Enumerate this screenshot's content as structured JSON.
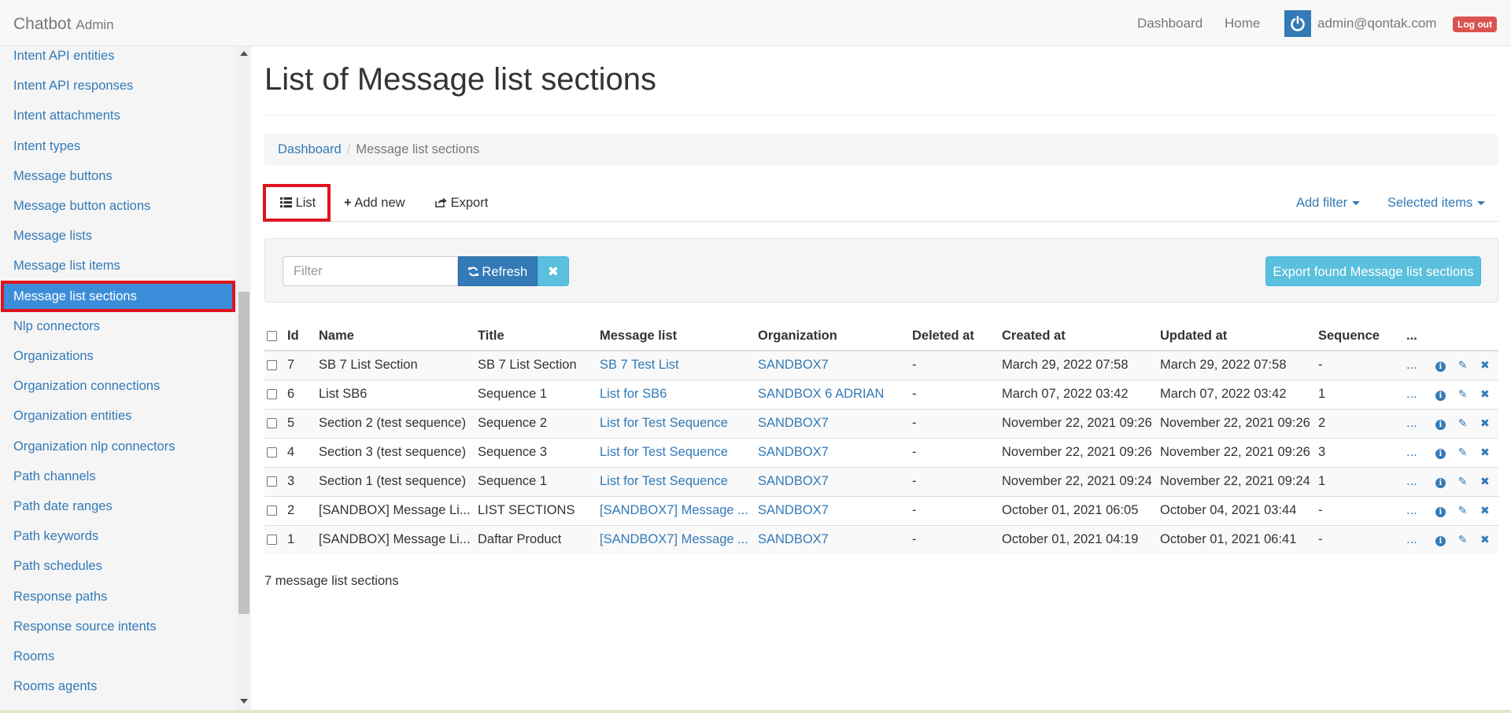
{
  "navbar": {
    "brand": "Chatbot",
    "brand_sub": "Admin",
    "dashboard": "Dashboard",
    "home": "Home",
    "user_email": "admin@qontak.com",
    "logout": "Log out"
  },
  "sidebar": {
    "items": [
      {
        "label": "Intent API entities"
      },
      {
        "label": "Intent API responses"
      },
      {
        "label": "Intent attachments"
      },
      {
        "label": "Intent types"
      },
      {
        "label": "Message buttons"
      },
      {
        "label": "Message button actions"
      },
      {
        "label": "Message lists"
      },
      {
        "label": "Message list items"
      },
      {
        "label": "Message list sections",
        "active": true
      },
      {
        "label": "Nlp connectors"
      },
      {
        "label": "Organizations"
      },
      {
        "label": "Organization connections"
      },
      {
        "label": "Organization entities"
      },
      {
        "label": "Organization nlp connectors"
      },
      {
        "label": "Path channels"
      },
      {
        "label": "Path date ranges"
      },
      {
        "label": "Path keywords"
      },
      {
        "label": "Path schedules"
      },
      {
        "label": "Response paths"
      },
      {
        "label": "Response source intents"
      },
      {
        "label": "Rooms"
      },
      {
        "label": "Rooms agents"
      }
    ]
  },
  "page": {
    "title": "List of Message list sections",
    "breadcrumb": {
      "home": "Dashboard",
      "current": "Message list sections"
    },
    "tabs": {
      "list": "List",
      "add_new": "Add new",
      "export": "Export"
    },
    "add_filter": "Add filter",
    "selected_items": "Selected items",
    "filter_placeholder": "Filter",
    "refresh": "Refresh",
    "export_found": "Export found Message list sections",
    "count_text": "7 message list sections"
  },
  "table": {
    "headers": {
      "id": "Id",
      "name": "Name",
      "title": "Title",
      "message_list": "Message list",
      "organization": "Organization",
      "deleted_at": "Deleted at",
      "created_at": "Created at",
      "updated_at": "Updated at",
      "sequence": "Sequence",
      "more": "..."
    },
    "rows": [
      {
        "id": "7",
        "name": "SB 7 List Section",
        "title": "SB 7 List Section",
        "message_list": "SB 7 Test List",
        "organization": "SANDBOX7",
        "deleted_at": "-",
        "created_at": "March 29, 2022 07:58",
        "updated_at": "March 29, 2022 07:58",
        "sequence": "-",
        "more": "..."
      },
      {
        "id": "6",
        "name": "List SB6",
        "title": "Sequence 1",
        "message_list": "List for SB6",
        "organization": "SANDBOX 6 ADRIAN",
        "deleted_at": "-",
        "created_at": "March 07, 2022 03:42",
        "updated_at": "March 07, 2022 03:42",
        "sequence": "1",
        "more": "..."
      },
      {
        "id": "5",
        "name": "Section 2 (test sequence)",
        "title": "Sequence 2",
        "message_list": "List for Test Sequence",
        "organization": "SANDBOX7",
        "deleted_at": "-",
        "created_at": "November 22, 2021 09:26",
        "updated_at": "November 22, 2021 09:26",
        "sequence": "2",
        "more": "..."
      },
      {
        "id": "4",
        "name": "Section 3 (test sequence)",
        "title": "Sequence 3",
        "message_list": "List for Test Sequence",
        "organization": "SANDBOX7",
        "deleted_at": "-",
        "created_at": "November 22, 2021 09:26",
        "updated_at": "November 22, 2021 09:26",
        "sequence": "3",
        "more": "..."
      },
      {
        "id": "3",
        "name": "Section 1 (test sequence)",
        "title": "Sequence 1",
        "message_list": "List for Test Sequence",
        "organization": "SANDBOX7",
        "deleted_at": "-",
        "created_at": "November 22, 2021 09:24",
        "updated_at": "November 22, 2021 09:24",
        "sequence": "1",
        "more": "..."
      },
      {
        "id": "2",
        "name": "[SANDBOX] Message Li...",
        "title": "LIST SECTIONS",
        "message_list": "[SANDBOX7] Message ...",
        "organization": "SANDBOX7",
        "deleted_at": "-",
        "created_at": "October 01, 2021 06:05",
        "updated_at": "October 04, 2021 03:44",
        "sequence": "-",
        "more": "..."
      },
      {
        "id": "1",
        "name": "[SANDBOX] Message Li...",
        "title": "Daftar Product",
        "message_list": "[SANDBOX7] Message ...",
        "organization": "SANDBOX7",
        "deleted_at": "-",
        "created_at": "October 01, 2021 04:19",
        "updated_at": "October 01, 2021 06:41",
        "sequence": "-",
        "more": "..."
      }
    ]
  },
  "colors": {
    "link": "#337ab7",
    "active_sidebar": "#3c8dd9",
    "highlight_border": "#e0141e",
    "info_button": "#5bc0de",
    "logout": "#d9534f"
  },
  "icons": {
    "list": "list-icon",
    "add": "plus-icon",
    "export": "share-icon",
    "refresh": "refresh-icon",
    "clear": "close-icon",
    "info": "info-icon",
    "edit": "pencil-icon",
    "delete": "close-icon",
    "power": "power-icon"
  }
}
